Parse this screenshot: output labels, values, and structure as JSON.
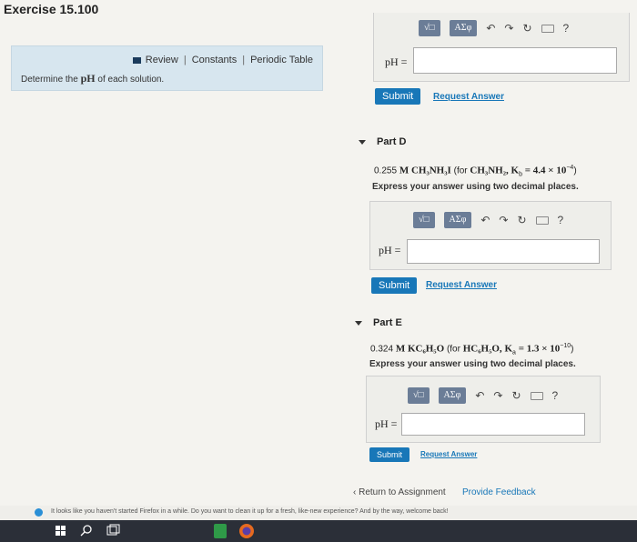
{
  "page": {
    "title": "Exercise 15.100"
  },
  "left_panel": {
    "links": {
      "review": "Review",
      "constants": "Constants",
      "periodic_table": "Periodic Table",
      "separator": "|"
    },
    "instruction": {
      "prefix": "Determine the ",
      "ph": "pH",
      "suffix": " of each solution."
    }
  },
  "part_c": {
    "ph_label": "pH =",
    "submit": "Submit",
    "request_answer": "Request Answer"
  },
  "part_d": {
    "title": "Part D",
    "q_conc": "0.255",
    "q_formula": "M CH₃NH₃I",
    "q_for": "(for",
    "q_base": "CH₃NH₂,",
    "q_kb": "K",
    "q_kb_sub": "b",
    "q_kb_val": "= 4.4 × 10",
    "q_exp": "−4",
    "q_close": ")",
    "express": "Express your answer using two decimal places.",
    "ph_label": "pH =",
    "submit": "Submit",
    "request_answer": "Request Answer"
  },
  "part_e": {
    "title": "Part E",
    "q_conc": "0.324",
    "q_formula": "M KC₆H₅O",
    "q_for": "(for",
    "q_acid": "HC₆H₅O,",
    "q_ka": "K",
    "q_ka_sub": "a",
    "q_ka_val": "= 1.3 × 10",
    "q_exp": "−10",
    "q_close": ")",
    "express": "Express your answer using two decimal places.",
    "ph_label": "pH =",
    "submit": "Submit",
    "request_answer": "Request Answer"
  },
  "toolbar": {
    "templates": "√□",
    "greek": "AΣφ",
    "undo": "↶",
    "redo": "↷",
    "reset": "↻",
    "help": "?"
  },
  "footer": {
    "return": "‹ Return to Assignment",
    "feedback": "Provide Feedback",
    "notification": "It looks like you haven't started Firefox in a while. Do you want to clean it up for a fresh, like-new experience? And by the way, welcome back!"
  },
  "colors": {
    "accent": "#1877b8",
    "panel": "#d7e6ef",
    "toolbar_btn": "#6b7d97",
    "taskbar": "#2b2f38"
  }
}
